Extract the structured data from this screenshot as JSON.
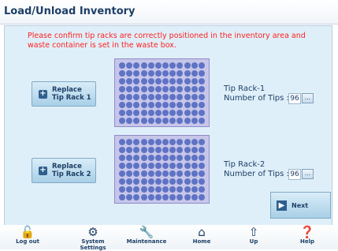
{
  "page": {
    "title": "Load/Unload Inventory"
  },
  "notice": "Please confirm tip racks are correctly positioned in the inventory area and waste container is set in the waste box.",
  "rack1": {
    "button_label_line1": "Replace",
    "button_label_line2": "Tip Rack 1",
    "name": "Tip Rack-1",
    "tips_label": "Number of Tips :",
    "tips_value": "96",
    "more_label": "..."
  },
  "rack2": {
    "button_label_line1": "Replace",
    "button_label_line2": "Tip Rack 2",
    "name": "Tip Rack-2",
    "tips_label": "Number of Tips :",
    "tips_value": "96",
    "more_label": "..."
  },
  "next": {
    "label": "Next"
  },
  "nav": {
    "items": [
      {
        "icon": "unlock-icon",
        "label": "Log out"
      },
      {
        "icon": "gear-icon",
        "label": "System Settings"
      },
      {
        "icon": "wrench-icon",
        "label": "Maintenance"
      },
      {
        "icon": "home-icon",
        "label": "Home"
      },
      {
        "icon": "up-arrow-icon",
        "label": "Up"
      },
      {
        "icon": "help-icon",
        "label": "Help"
      }
    ]
  }
}
